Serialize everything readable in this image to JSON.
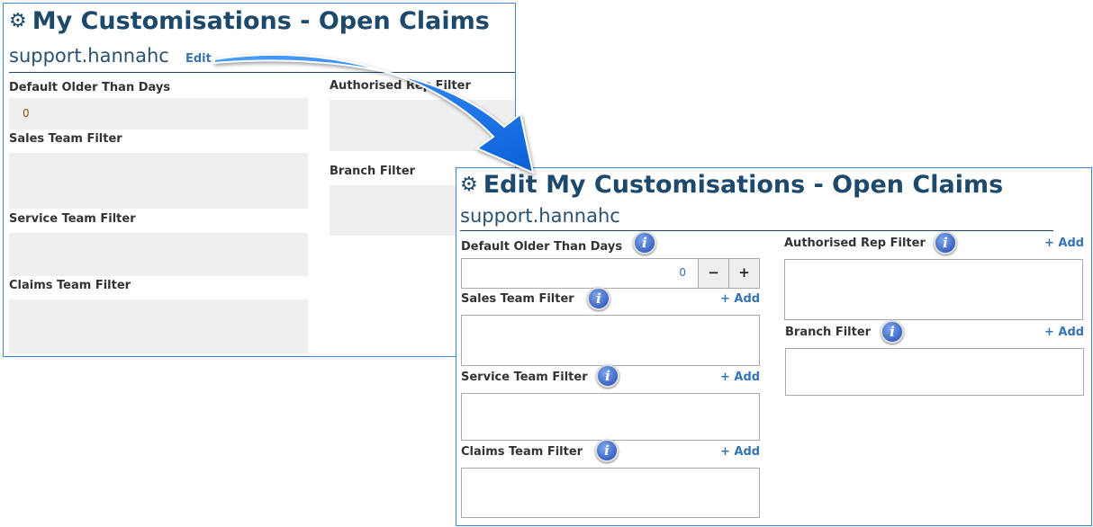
{
  "view": {
    "title": "My Customisations - Open Claims",
    "username": "support.hannahc",
    "edit_link": "Edit",
    "fields": {
      "default_older_than_days": {
        "label": "Default Older Than Days",
        "value": "0"
      },
      "sales_team": {
        "label": "Sales Team Filter"
      },
      "service_team": {
        "label": "Service Team Filter"
      },
      "claims_team": {
        "label": "Claims Team Filter"
      },
      "authorised_rep": {
        "label": "Authorised Rep Filter"
      },
      "branch": {
        "label": "Branch Filter"
      }
    }
  },
  "edit": {
    "title": "Edit My Customisations - Open Claims",
    "username": "support.hannahc",
    "add_label": "+ Add",
    "info_glyph": "i",
    "minus": "−",
    "plus": "+",
    "fields": {
      "default_older_than_days": {
        "label": "Default Older Than Days",
        "value": "0"
      },
      "sales_team": {
        "label": "Sales Team Filter"
      },
      "service_team": {
        "label": "Service Team Filter"
      },
      "claims_team": {
        "label": "Claims Team Filter"
      },
      "authorised_rep": {
        "label": "Authorised Rep Filter"
      },
      "branch": {
        "label": "Branch Filter"
      }
    }
  },
  "colors": {
    "heading": "#1d4a6c",
    "link": "#3674b4",
    "arrow": "#1a73e8"
  }
}
